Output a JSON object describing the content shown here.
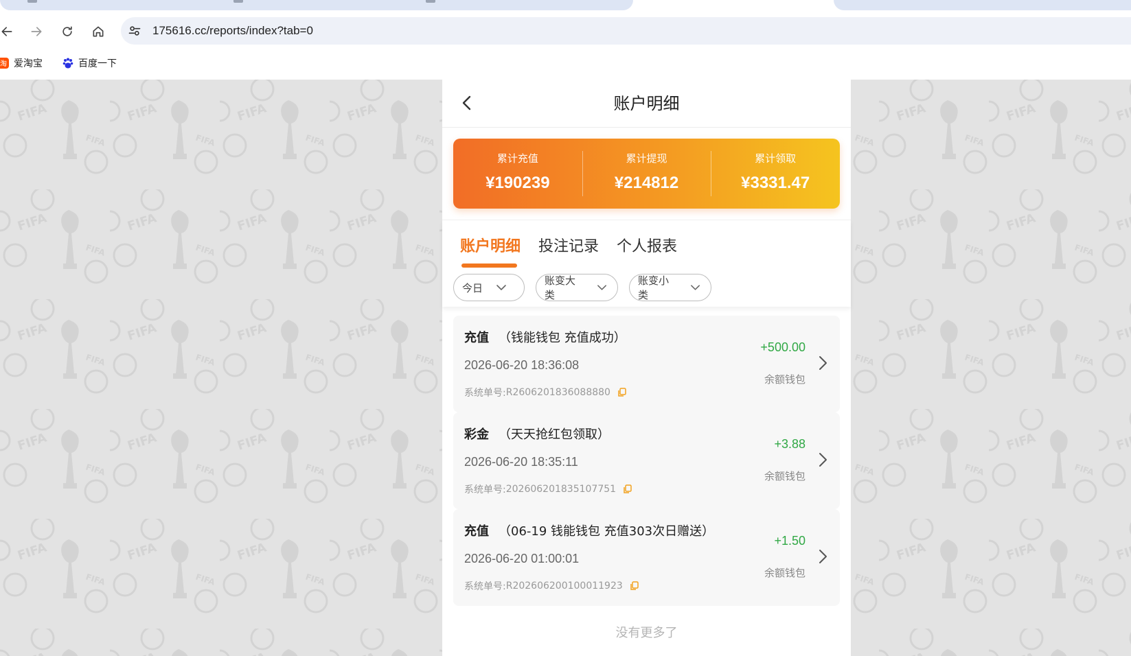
{
  "browser": {
    "url": "175616.cc/reports/index?tab=0",
    "bookmarks": [
      {
        "label": "爱淘宝",
        "icon": "taobao-icon"
      },
      {
        "label": "百度一下",
        "icon": "baidu-paw-icon"
      }
    ]
  },
  "header": {
    "title": "账户明细"
  },
  "summary": [
    {
      "label": "累计充值",
      "value": "¥190239"
    },
    {
      "label": "累计提现",
      "value": "¥214812"
    },
    {
      "label": "累计领取",
      "value": "¥3331.47"
    }
  ],
  "tabs": [
    {
      "label": "账户明细",
      "active": true
    },
    {
      "label": "投注记录",
      "active": false
    },
    {
      "label": "个人报表",
      "active": false
    }
  ],
  "filters": [
    {
      "label": "今日"
    },
    {
      "label": "账变大类"
    },
    {
      "label": "账变小类"
    }
  ],
  "records": [
    {
      "type": "充值",
      "desc": "（钱能钱包 充值成功）",
      "time": "2026-06-20 18:36:08",
      "order_label": "系统单号:",
      "order_no": "R2606201836088880",
      "amount": "+500.00",
      "wallet": "余额钱包"
    },
    {
      "type": "彩金",
      "desc": "（天天抢红包领取）",
      "time": "2026-06-20 18:35:11",
      "order_label": "系统单号:",
      "order_no": "202606201835107751",
      "amount": "+3.88",
      "wallet": "余额钱包"
    },
    {
      "type": "充值",
      "desc": "（06-19 钱能钱包 充值303次日赠送）",
      "time": "2026-06-20 01:00:01",
      "order_label": "系统单号:",
      "order_no": "R202606200100011923",
      "amount": "+1.50",
      "wallet": "余额钱包"
    }
  ],
  "footer": {
    "no_more": "没有更多了"
  },
  "colors": {
    "accent": "#f2771f",
    "amount_positive": "#31a845",
    "summary_gradient": [
      "#f26d26",
      "#f5c41f"
    ]
  }
}
